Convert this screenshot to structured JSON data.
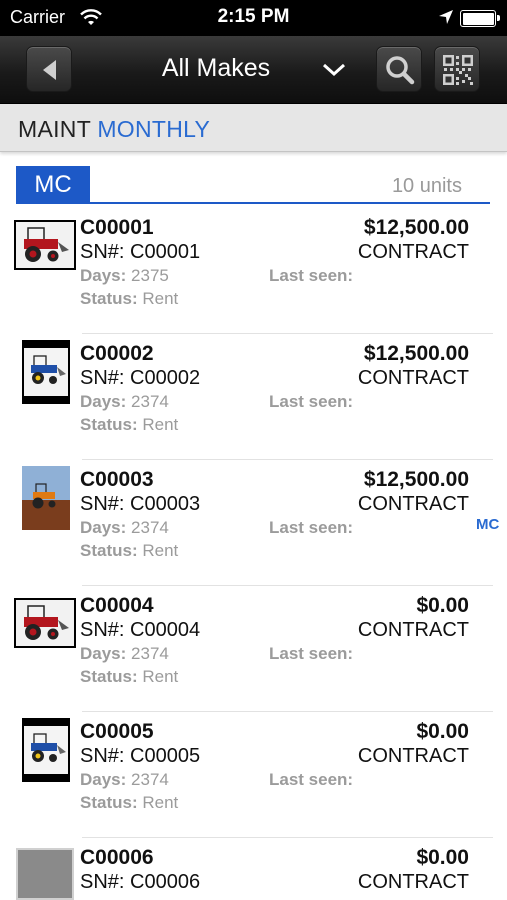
{
  "status_bar": {
    "carrier": "Carrier",
    "time": "2:15 PM"
  },
  "nav": {
    "title": "All Makes"
  },
  "section": {
    "prefix": "MAINT",
    "highlight": "MONTHLY"
  },
  "group": {
    "tag": "MC",
    "count": "10 units"
  },
  "labels": {
    "days": "Days:",
    "status": "Status:",
    "last_seen": "Last seen:"
  },
  "rows": [
    {
      "unit": "C00001",
      "sn": "SN#: C00001",
      "days": "2375",
      "status": "Rent",
      "price": "$12,500.00",
      "contract": "CONTRACT",
      "image": "red-tractor"
    },
    {
      "unit": "C00002",
      "sn": "SN#: C00002",
      "days": "2374",
      "status": "Rent",
      "price": "$12,500.00",
      "contract": "CONTRACT",
      "image": "blue-tractor"
    },
    {
      "unit": "C00003",
      "sn": "SN#: C00003",
      "days": "2374",
      "status": "Rent",
      "price": "$12,500.00",
      "contract": "CONTRACT",
      "image": "orange-tractor-field"
    },
    {
      "unit": "C00004",
      "sn": "SN#: C00004",
      "days": "2374",
      "status": "Rent",
      "price": "$0.00",
      "contract": "CONTRACT",
      "image": "red-tractor"
    },
    {
      "unit": "C00005",
      "sn": "SN#: C00005",
      "days": "2374",
      "status": "Rent",
      "price": "$0.00",
      "contract": "CONTRACT",
      "image": "blue-tractor"
    },
    {
      "unit": "C00006",
      "sn": "SN#: C00006",
      "days": "",
      "status": "",
      "price": "$0.00",
      "contract": "CONTRACT",
      "image": "placeholder"
    }
  ],
  "index": {
    "label": "MC"
  },
  "colors": {
    "accent": "#1d59c7",
    "link": "#2a6bd1",
    "muted": "#9b9b9b"
  }
}
